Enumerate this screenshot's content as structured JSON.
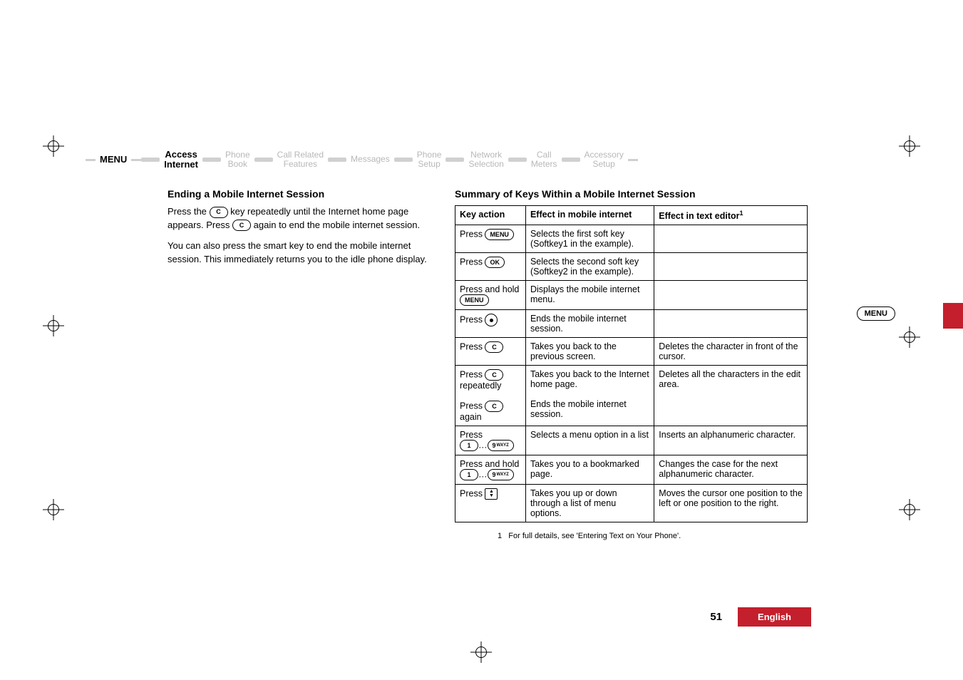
{
  "menu": {
    "label_menu": "MENU",
    "items": [
      {
        "l1": "Access",
        "l2": "Internet"
      },
      {
        "l1": "Phone",
        "l2": "Book"
      },
      {
        "l1": "Call Related",
        "l2": "Features"
      },
      {
        "l1": "Messages",
        "l2": ""
      },
      {
        "l1": "Phone",
        "l2": "Setup"
      },
      {
        "l1": "Network",
        "l2": "Selection"
      },
      {
        "l1": "Call",
        "l2": "Meters"
      },
      {
        "l1": "Accessory",
        "l2": "Setup"
      }
    ]
  },
  "left": {
    "h": "Ending a Mobile Internet Session",
    "p1a": "Press the ",
    "p1b": " key repeatedly until the Internet home page appears. Press ",
    "p1c": " again to end the mobile internet session.",
    "p2": "You can also press the smart key to end the mobile internet session. This immediately returns you to the idle phone display."
  },
  "right": {
    "h": "Summary of Keys Within a Mobile Internet Session",
    "th1": "Key action",
    "th2": "Effect in mobile internet",
    "th3": "Effect in text editor",
    "sup": "1",
    "rows": [
      {
        "k_pre": "Press ",
        "k_btn": "MENU",
        "k_post": "",
        "eff": "Selects the first soft key (Softkey1 in the example).",
        "txt": ""
      },
      {
        "k_pre": "Press ",
        "k_btn": "OK",
        "k_post": "",
        "eff": "Selects the second soft key (Softkey2 in the example).",
        "txt": ""
      },
      {
        "k_pre": "Press and hold ",
        "k_btn": "MENU",
        "k_post": "",
        "eff": "Displays the mobile internet menu.",
        "txt": ""
      },
      {
        "k_pre": "Press ",
        "k_btn": "SMART",
        "k_post": "",
        "eff": "Ends the mobile internet session.",
        "txt": ""
      },
      {
        "k_pre": "Press ",
        "k_btn": "C",
        "k_post": "",
        "eff": "Takes you back to the previous screen.",
        "txt": "Deletes the character in front of the cursor."
      },
      {
        "k_pre": "Press ",
        "k_btn": "C",
        "k_post": " repeatedly",
        "k2_pre": "Press ",
        "k2_btn": "C",
        "k2_post": " again",
        "eff": "Takes you back to the Internet home page.",
        "eff2": "Ends the mobile internet session.",
        "txt": "Deletes all the characters in the edit area."
      },
      {
        "k_pre": "Press ",
        "k_btn": "1..9",
        "k_post": "",
        "eff": "Selects a menu option in a list",
        "txt": "Inserts an alphanumeric character."
      },
      {
        "k_pre": "Press and hold ",
        "k_btn": "1..9",
        "k_post": "",
        "eff": "Takes you to a bookmarked page.",
        "txt": "Changes the case for the next alphanumeric character."
      },
      {
        "k_pre": "Press ",
        "k_btn": "UPDN",
        "k_post": "",
        "eff": "Takes you up or down through a list of menu options.",
        "txt": "Moves the cursor one position to the left or one position to the right."
      }
    ],
    "footnote_num": "1",
    "footnote": "For full details, see 'Entering Text on Your Phone'."
  },
  "side": {
    "label": "MENU"
  },
  "footer": {
    "page": "51",
    "lang": "English"
  },
  "btn": {
    "C": "C",
    "OK": "OK",
    "MENU": "MENU",
    "one": "1",
    "nine": "9",
    "wxyz": "WXYZ"
  }
}
